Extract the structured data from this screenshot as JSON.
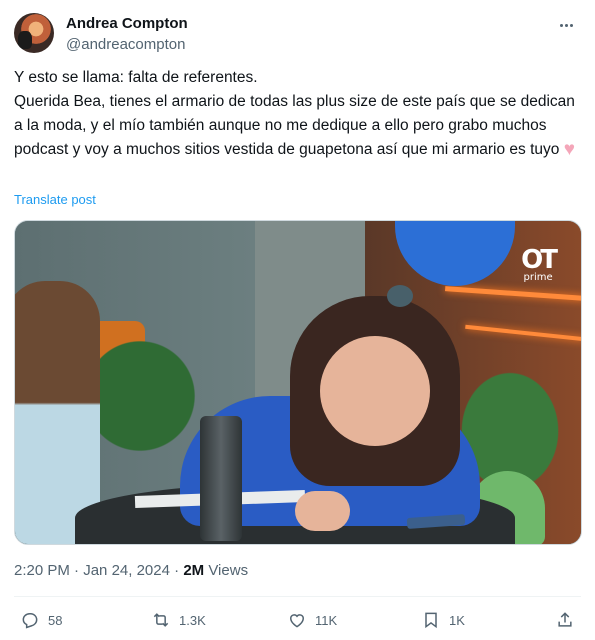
{
  "author": {
    "display_name": "Andrea Compton",
    "handle": "@andreacompton"
  },
  "tweet": {
    "text": "Y esto se llama: falta de referentes.\nQuerida Bea, tienes el armario de todas las plus size de este país que se dedican a la moda, y el mío también aunque no me dedique a ello pero grabo muchos podcast y voy a muchos sitios vestida de guapetona así que mi armario es tuyo",
    "emoji": "♥",
    "translate_label": "Translate post"
  },
  "media": {
    "logo_mark": "OT",
    "logo_sub": "prime"
  },
  "meta": {
    "time": "2:20 PM",
    "separator": " · ",
    "date": "Jan 24, 2024",
    "views_count": "2M",
    "views_label": "Views"
  },
  "actions": {
    "replies": "58",
    "reposts": "1.3K",
    "likes": "11K",
    "bookmarks": "1K"
  },
  "icons": {
    "more": "more-icon",
    "reply": "reply-icon",
    "repost": "repost-icon",
    "like": "like-icon",
    "bookmark": "bookmark-icon",
    "share": "share-icon"
  }
}
